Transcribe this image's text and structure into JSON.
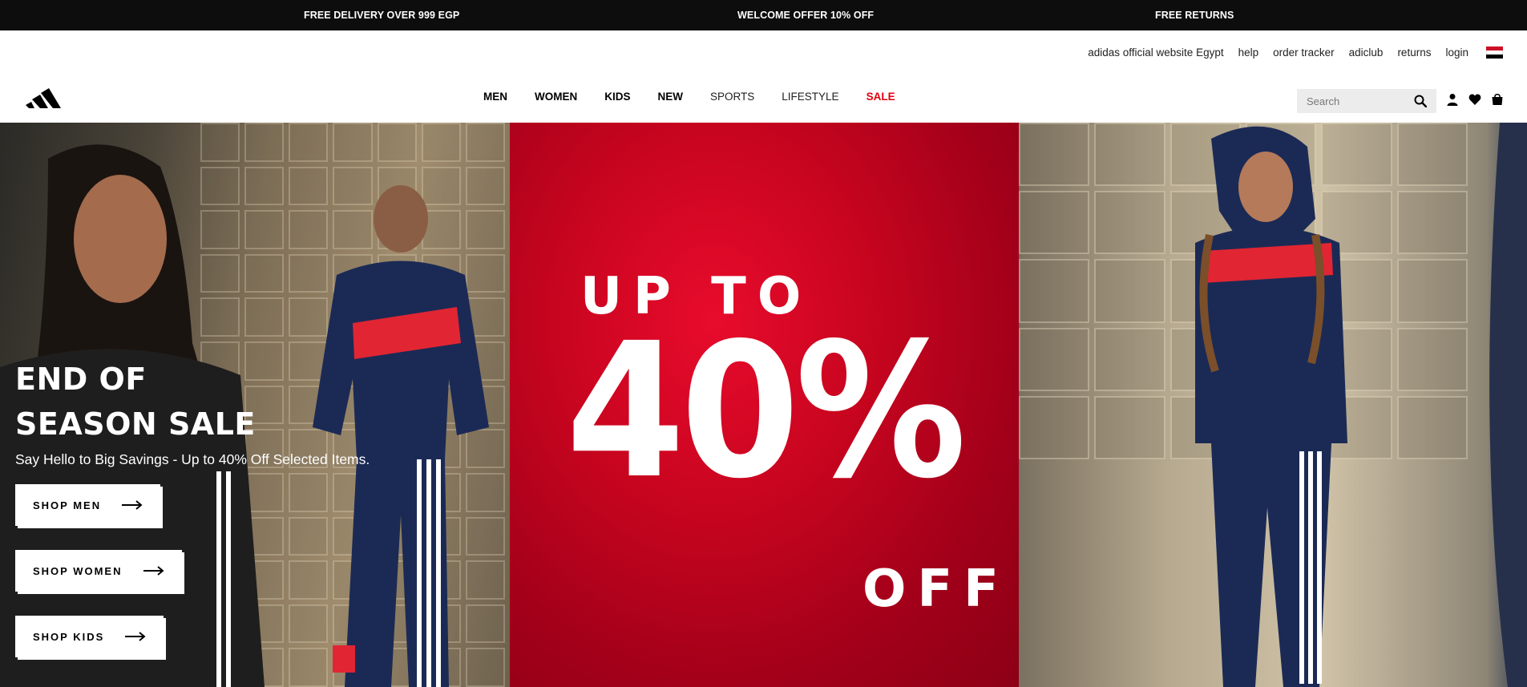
{
  "promo_bar": {
    "items": [
      "FREE DELIVERY OVER 999 EGP",
      "WELCOME OFFER 10% OFF",
      "FREE RETURNS"
    ]
  },
  "utility_links": [
    "adidas official website Egypt",
    "help",
    "order tracker",
    "adiclub",
    "returns",
    "login"
  ],
  "flag": {
    "name": "egypt-flag-icon",
    "colors": [
      "#ce1126",
      "#ffffff",
      "#000000"
    ]
  },
  "nav": {
    "items": [
      {
        "label": "MEN",
        "style": "bold"
      },
      {
        "label": "WOMEN",
        "style": "bold"
      },
      {
        "label": "KIDS",
        "style": "bold"
      },
      {
        "label": "NEW",
        "style": "bold"
      },
      {
        "label": "SPORTS",
        "style": "light"
      },
      {
        "label": "LIFESTYLE",
        "style": "light"
      },
      {
        "label": "SALE",
        "style": "sale"
      }
    ],
    "search_placeholder": "Search",
    "icons": [
      "user-icon",
      "heart-icon",
      "bag-icon"
    ]
  },
  "hero": {
    "title_line1": "END OF",
    "title_line2": "SEASON SALE",
    "subtitle": "Say Hello to Big Savings - Up to 40% Off Selected Items.",
    "buttons": [
      "SHOP MEN",
      "SHOP WOMEN",
      "SHOP KIDS"
    ],
    "promo_up_to": "UP TO",
    "promo_percent": "40%",
    "promo_off": "OFF"
  },
  "colors": {
    "accent_red": "#e3000f",
    "promo_bar_bg": "#0d0d0d",
    "promo_panel_red": "#c9051f"
  }
}
